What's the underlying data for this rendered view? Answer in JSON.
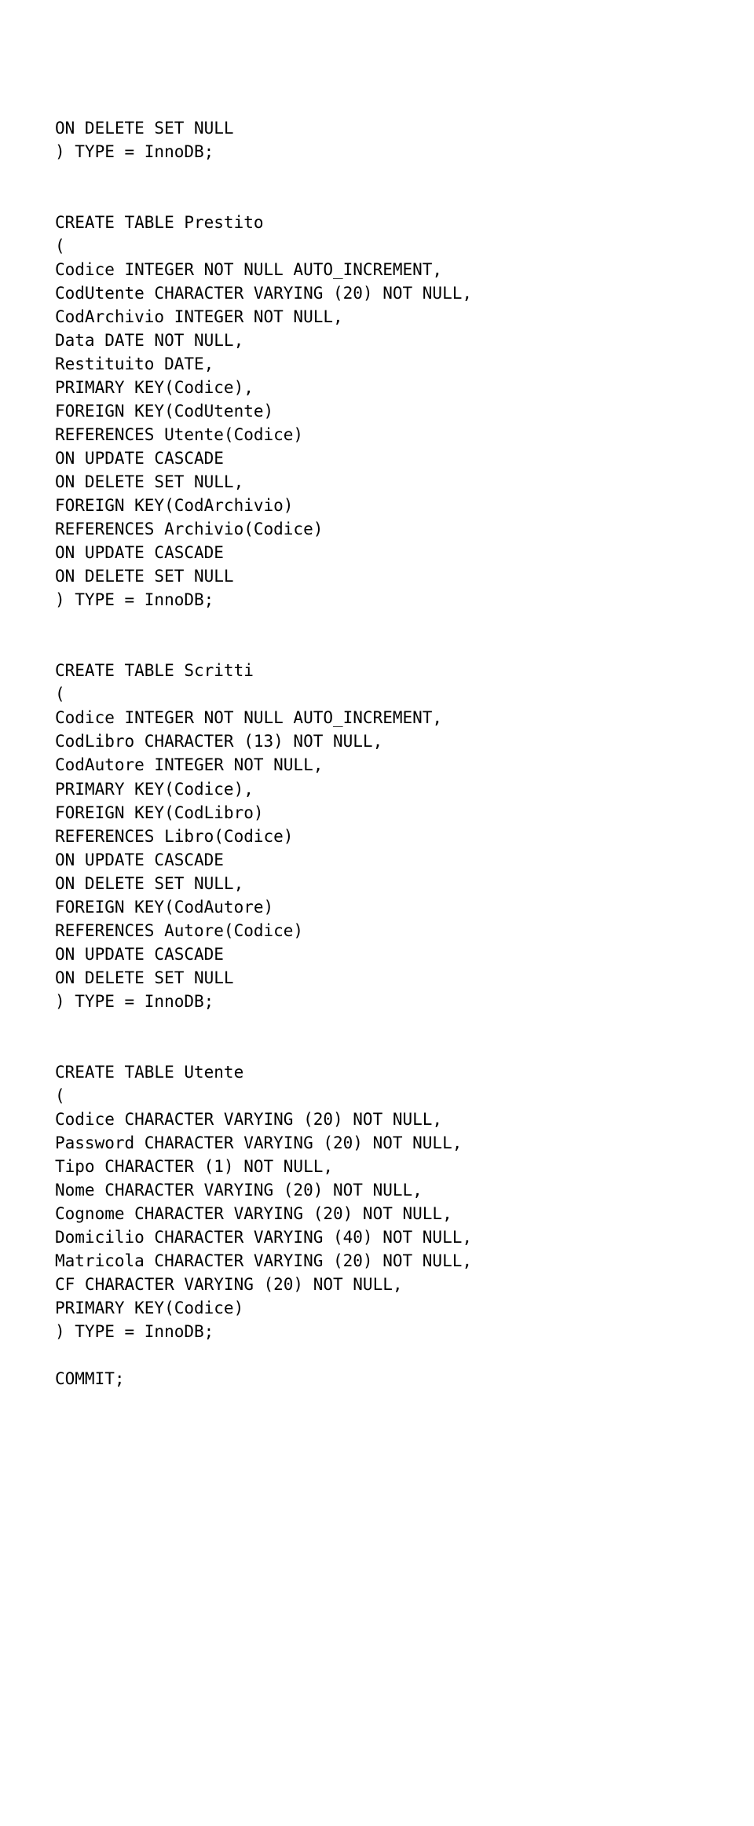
{
  "sql": {
    "lines": [
      "ON DELETE SET NULL",
      ") TYPE = InnoDB;",
      "",
      "",
      "CREATE TABLE Prestito",
      "(",
      "Codice INTEGER NOT NULL AUTO_INCREMENT,",
      "CodUtente CHARACTER VARYING (20) NOT NULL,",
      "CodArchivio INTEGER NOT NULL,",
      "Data DATE NOT NULL,",
      "Restituito DATE,",
      "PRIMARY KEY(Codice),",
      "FOREIGN KEY(CodUtente)",
      "REFERENCES Utente(Codice)",
      "ON UPDATE CASCADE",
      "ON DELETE SET NULL,",
      "FOREIGN KEY(CodArchivio)",
      "REFERENCES Archivio(Codice)",
      "ON UPDATE CASCADE",
      "ON DELETE SET NULL",
      ") TYPE = InnoDB;",
      "",
      "",
      "CREATE TABLE Scritti",
      "(",
      "Codice INTEGER NOT NULL AUTO_INCREMENT,",
      "CodLibro CHARACTER (13) NOT NULL,",
      "CodAutore INTEGER NOT NULL,",
      "PRIMARY KEY(Codice),",
      "FOREIGN KEY(CodLibro)",
      "REFERENCES Libro(Codice)",
      "ON UPDATE CASCADE",
      "ON DELETE SET NULL,",
      "FOREIGN KEY(CodAutore)",
      "REFERENCES Autore(Codice)",
      "ON UPDATE CASCADE",
      "ON DELETE SET NULL",
      ") TYPE = InnoDB;",
      "",
      "",
      "CREATE TABLE Utente",
      "(",
      "Codice CHARACTER VARYING (20) NOT NULL,",
      "Password CHARACTER VARYING (20) NOT NULL,",
      "Tipo CHARACTER (1) NOT NULL,",
      "Nome CHARACTER VARYING (20) NOT NULL,",
      "Cognome CHARACTER VARYING (20) NOT NULL,",
      "Domicilio CHARACTER VARYING (40) NOT NULL,",
      "Matricola CHARACTER VARYING (20) NOT NULL,",
      "CF CHARACTER VARYING (20) NOT NULL,",
      "PRIMARY KEY(Codice)",
      ") TYPE = InnoDB;",
      "",
      "COMMIT;"
    ]
  }
}
